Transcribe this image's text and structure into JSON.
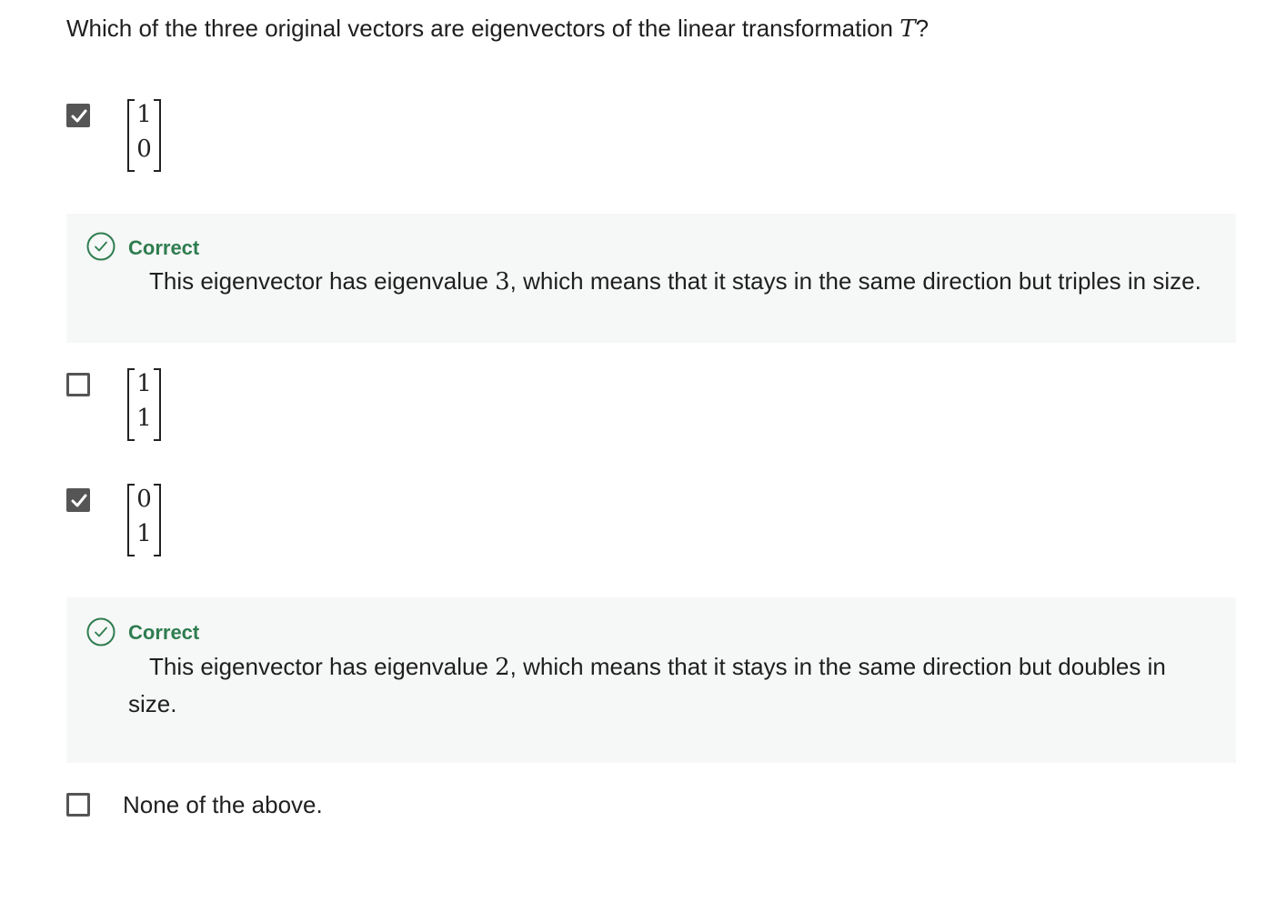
{
  "question": {
    "text": "Which of the three original vectors are eigenvectors of the linear transformation ",
    "variable": "T",
    "suffix": "?"
  },
  "options": [
    {
      "checked": true,
      "vector": [
        "1",
        "0"
      ],
      "feedback": {
        "status": "Correct",
        "text_before": "This eigenvector has eigenvalue ",
        "eigenvalue": "3",
        "text_after": ", which means that it stays in the same direction but triples in size."
      }
    },
    {
      "checked": false,
      "vector": [
        "1",
        "1"
      ]
    },
    {
      "checked": true,
      "vector": [
        "0",
        "1"
      ],
      "feedback": {
        "status": "Correct",
        "text_before": "This eigenvector has eigenvalue ",
        "eigenvalue": "2",
        "text_after": ", which means that it stays in the same direction but doubles in size."
      }
    },
    {
      "checked": false,
      "label": "None of the above."
    }
  ],
  "colors": {
    "checkbox": "#555555",
    "correct_green": "#2e7d4f",
    "feedback_bg": "#f6f7f7"
  },
  "icons": {
    "checkbox_checked": "check-mark-icon",
    "correct": "check-circle-icon"
  }
}
